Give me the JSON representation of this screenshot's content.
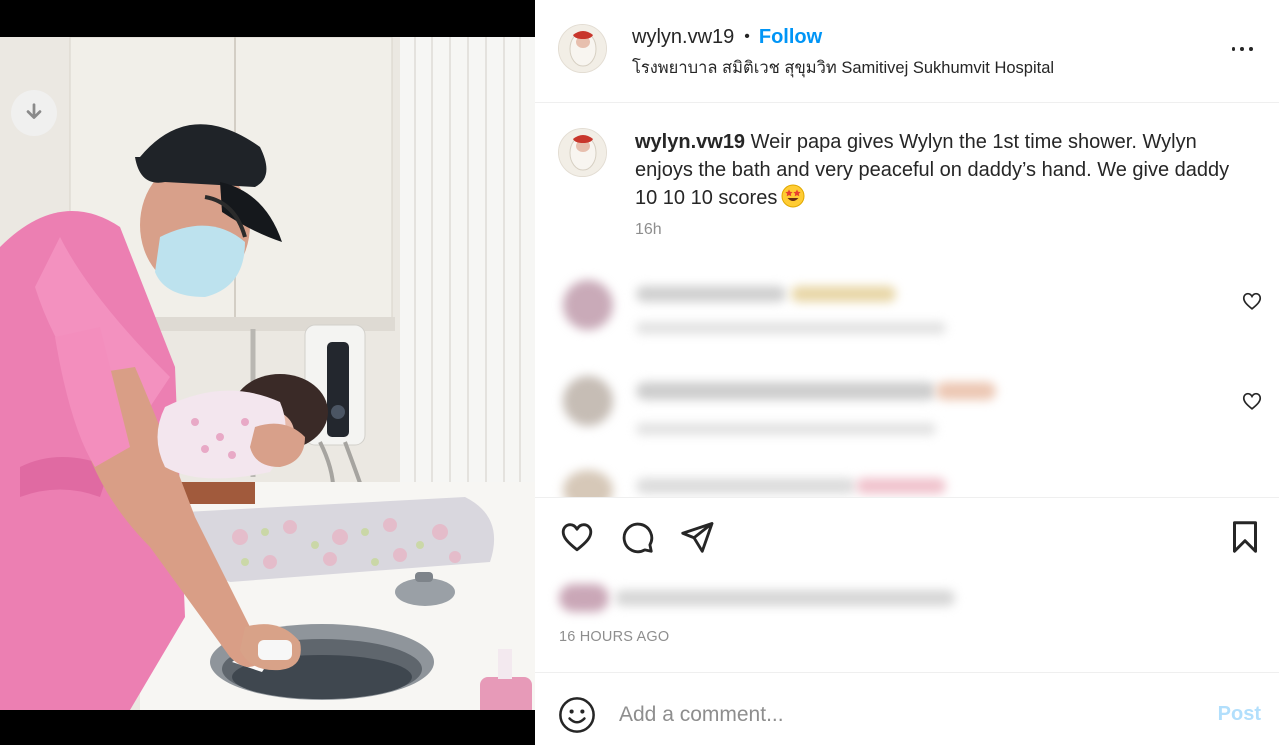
{
  "media": {
    "download_label": "download"
  },
  "header": {
    "username": "wylyn.vw19",
    "separator": "•",
    "follow_label": "Follow",
    "location": "โรงพยาบาล สมิติเวช สุขุมวิท Samitivej Sukhumvit Hospital"
  },
  "caption": {
    "username": "wylyn.vw19",
    "text": " Weir papa gives Wylyn the 1st time shower. Wylyn enjoys the bath and very peaceful on daddy’s hand. We give daddy 10 10 10 scores",
    "emoji": "star-struck-emoji",
    "time": "16h"
  },
  "post": {
    "timestamp": "16 HOURS AGO"
  },
  "comment_box": {
    "placeholder": "Add a comment...",
    "post_label": "Post"
  },
  "colors": {
    "accent": "#0095f6",
    "post_disabled": "#b2dffc",
    "secondary_text": "#8e8e8e",
    "divider": "#efefef"
  },
  "icons": [
    "download-icon",
    "more-icon",
    "heart-icon",
    "comment-icon",
    "share-icon",
    "bookmark-icon",
    "smile-icon"
  ]
}
